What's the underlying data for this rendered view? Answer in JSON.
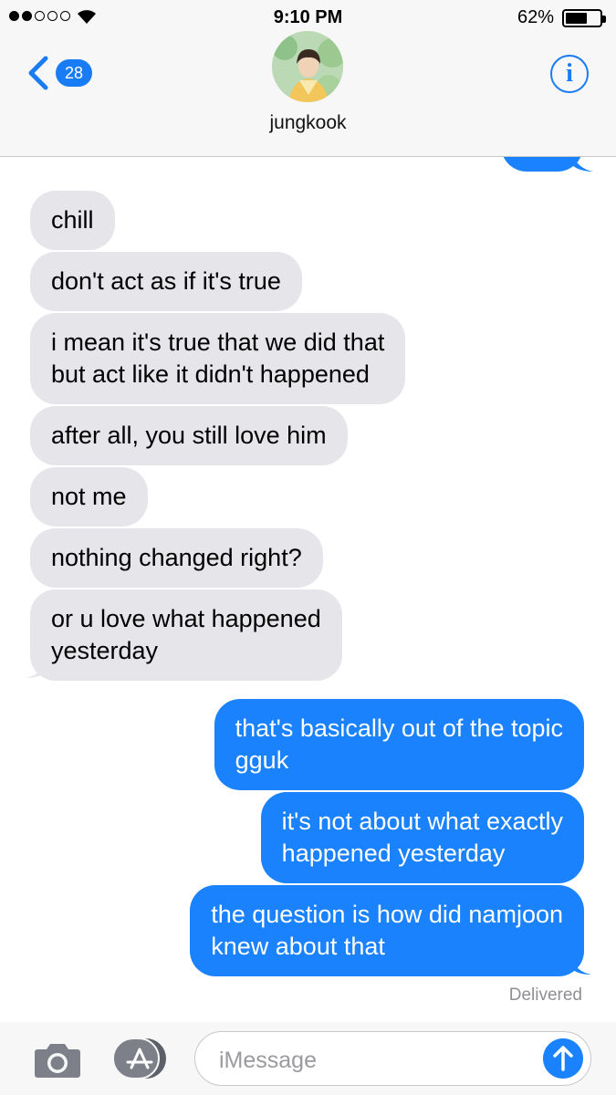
{
  "status_bar": {
    "time": "9:10 PM",
    "battery_percent": "62%",
    "battery_level": 0.62,
    "signal_bars_filled": 2,
    "signal_bars_total": 5
  },
  "header": {
    "back_badge": "28",
    "contact_name": "jungkook",
    "info_glyph": "i"
  },
  "messages": [
    {
      "dir": "in",
      "text": "chill"
    },
    {
      "dir": "in",
      "text": "don't act as if it's true"
    },
    {
      "dir": "in",
      "text": "i mean it's true that we did that\nbut act like it didn't happened"
    },
    {
      "dir": "in",
      "text": "after all, you still love him"
    },
    {
      "dir": "in",
      "text": "not me"
    },
    {
      "dir": "in",
      "text": "nothing changed right?"
    },
    {
      "dir": "in",
      "text": "or u love what happened\nyesterday"
    },
    {
      "dir": "out",
      "text": "that's basically out of the topic\ngguk"
    },
    {
      "dir": "out",
      "text": "it's not about what exactly\nhappened yesterday"
    },
    {
      "dir": "out",
      "text": "the question is how did namjoon\nknew about that"
    }
  ],
  "delivered_label": "Delivered",
  "input": {
    "placeholder": "iMessage"
  },
  "colors": {
    "incoming_bubble": "#e5e5ea",
    "outgoing_bubble": "#1982fc",
    "accent": "#1a7cf5"
  },
  "icons": [
    "back-chevron-icon",
    "info-icon",
    "camera-icon",
    "app-store-icon",
    "send-arrow-icon",
    "wifi-icon",
    "battery-icon"
  ]
}
